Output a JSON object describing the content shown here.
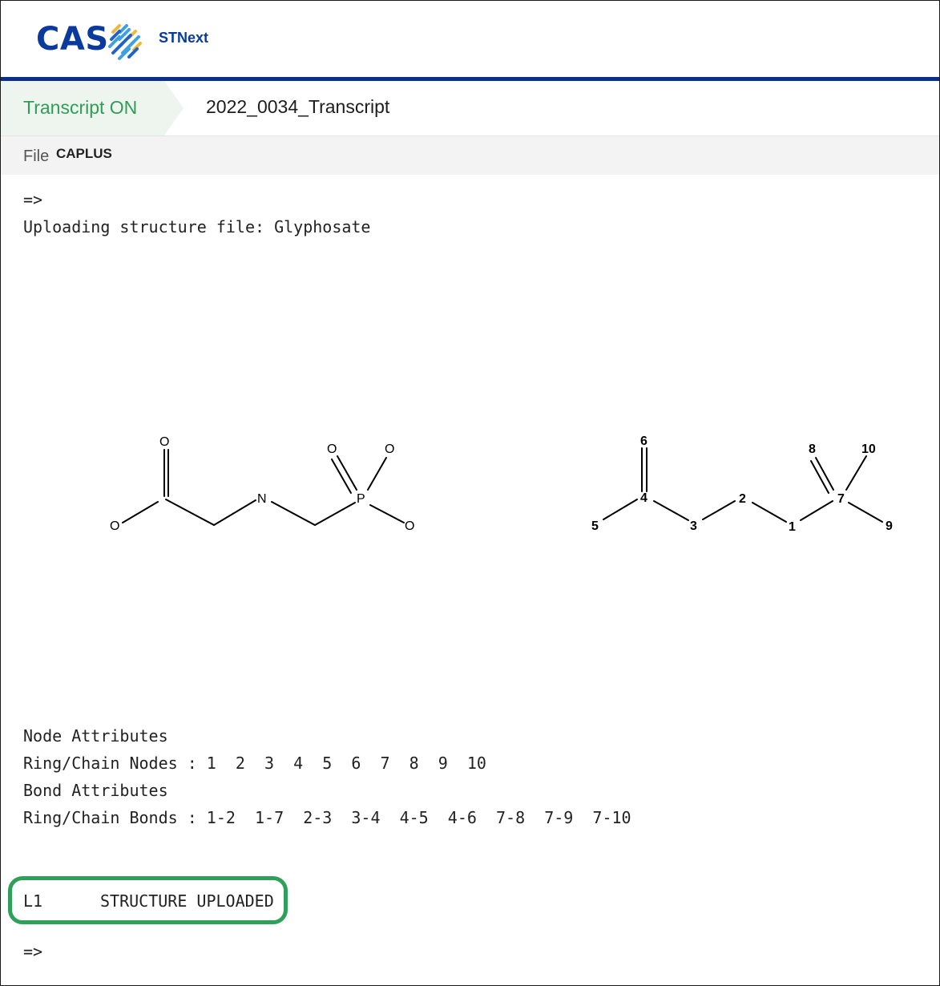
{
  "header": {
    "logo": "CAS",
    "product": "STNext",
    "accent": "#0b2f8a"
  },
  "transcript": {
    "status": "Transcript ON",
    "status_color": "#2f9d56",
    "name": "2022_0034_Transcript"
  },
  "file": {
    "label": "File",
    "value": "CAPLUS"
  },
  "session": {
    "prompt_top": "=>",
    "upload_message": "Uploading structure file: Glyphosate",
    "structure_left": {
      "atoms": [
        "O",
        "O",
        "N",
        "O",
        "O",
        "P",
        "O"
      ]
    },
    "structure_right": {
      "node_labels": [
        "6",
        "8",
        "10",
        "4",
        "2",
        "7",
        "5",
        "3",
        "1",
        "9"
      ]
    },
    "node_attributes_title": "Node Attributes",
    "ring_chain_nodes": "Ring/Chain Nodes : 1  2  3  4  5  6  7  8  9  10",
    "bond_attributes_title": "Bond Attributes",
    "ring_chain_bonds": "Ring/Chain Bonds : 1-2  1-7  2-3  3-4  4-5  4-6  7-8  7-9  7-10",
    "result_id": "L1",
    "result_text": "STRUCTURE UPLOADED",
    "prompt_bottom": "=>"
  }
}
